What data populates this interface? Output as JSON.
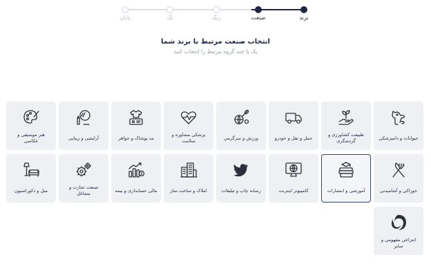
{
  "stepper": {
    "steps": [
      {
        "label": "برند",
        "state": "active"
      },
      {
        "label": "صنعت",
        "state": "active"
      },
      {
        "label": "رنگ",
        "state": "inactive"
      },
      {
        "label": "تگ",
        "state": "inactive"
      },
      {
        "label": "پایان",
        "state": "inactive"
      }
    ]
  },
  "heading": {
    "title": "انتخاب صنعت مرتبط با برند شما",
    "subtitle": "یک یا چند گروه مرتبط را انتخاب کنید"
  },
  "industries": [
    {
      "label": "حیوانات و دامپزشکی",
      "icon": "dog-icon",
      "selected": false
    },
    {
      "label": "طبیعت کشاورزی و گردشگری",
      "icon": "plant-hand-icon",
      "selected": false
    },
    {
      "label": "حمل و نقل و خودرو",
      "icon": "truck-icon",
      "selected": false
    },
    {
      "label": "ورزش و سرگرمی",
      "icon": "sports-icon",
      "selected": false
    },
    {
      "label": "پزشکی مشاوره و سلامت",
      "icon": "heartbeat-icon",
      "selected": false
    },
    {
      "label": "مد پوشاک و جواهر",
      "icon": "clothing-icon",
      "selected": false
    },
    {
      "label": "آرایشی و زیبایی",
      "icon": "mirror-icon",
      "selected": false
    },
    {
      "label": "هنر موسیقی و عکاسی",
      "icon": "palette-icon",
      "selected": false
    },
    {
      "label": "خوراکی و آشامیدنی",
      "icon": "fork-knife-icon",
      "selected": false
    },
    {
      "label": "آموزشی و انتشارات",
      "icon": "books-icon",
      "selected": true
    },
    {
      "label": "کامپیوتر اینترنت",
      "icon": "computer-globe-icon",
      "selected": false
    },
    {
      "label": "رسانه چاپ و تبلیغات",
      "icon": "bird-icon",
      "selected": false
    },
    {
      "label": "املاک و ساخت ساز",
      "icon": "buildings-icon",
      "selected": false
    },
    {
      "label": "مالی حسابداری و بیمه",
      "icon": "finance-chart-icon",
      "selected": false
    },
    {
      "label": "صنعت تجارت و مشاغل",
      "icon": "gears-icon",
      "selected": false
    },
    {
      "label": "مبل و دکوراسیون",
      "icon": "lamp-sofa-icon",
      "selected": false
    },
    {
      "label": "انتزاعی مفهومی و سایر",
      "icon": "abstract-swirl-icon",
      "selected": false
    }
  ],
  "colors": {
    "accent": "#1f2544",
    "card_bg": "#eef0f3",
    "selected_border": "#39466a",
    "muted_text": "#9aa0ab"
  }
}
